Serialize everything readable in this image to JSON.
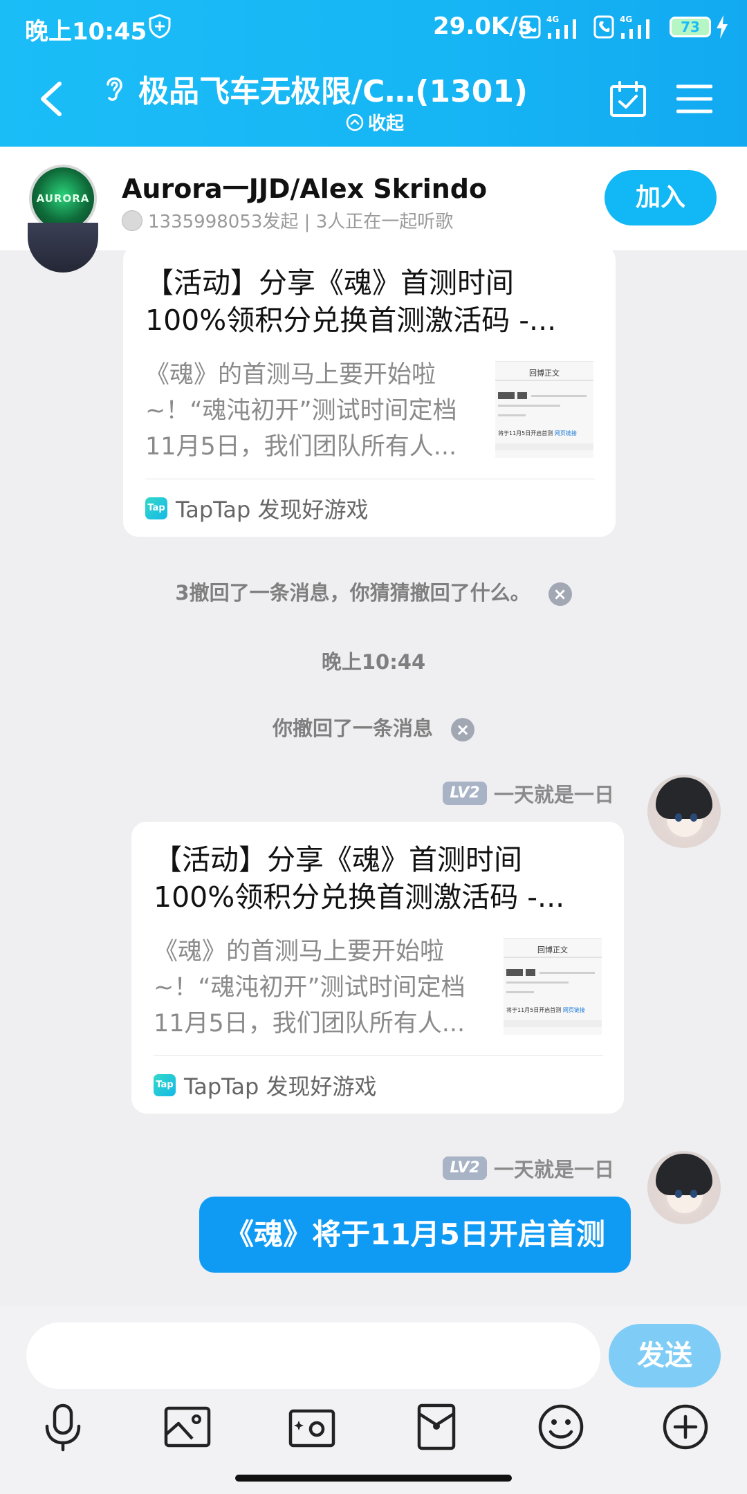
{
  "status_bar": {
    "time": "晚上10:45",
    "network_speed": "29.0K/s",
    "network_type_1": "4G",
    "network_type_2": "4G",
    "battery": "73"
  },
  "header": {
    "title": "极品飞车无极限/C…(1301)",
    "collapse_label": "收起"
  },
  "room": {
    "name": "Aurora一JJD/Alex Skrindo",
    "avatar_text": "AURORA",
    "sub": "1335998053发起 | 3人正在一起听歌",
    "join_label": "加入"
  },
  "messages": {
    "card1": {
      "title": "【活动】分享《魂》首测时间100%领积分兑换首测激活码 -...",
      "desc": "《魂》的首测马上要开始啦~！“魂沌初开”测试时间定档11月5日，我们团队所有人...",
      "thumb_title": "回博正文",
      "thumb_text": "将于11月5日开启首测",
      "thumb_link": "网页链接",
      "source": "TapTap 发现好游戏",
      "tap_icon": "Tap"
    },
    "recall_notice": "3撤回了一条消息，你猜猜撤回了什么。",
    "timestamp": "晚上10:44",
    "self_recall_notice": "你撤回了一条消息",
    "sender_level": "LV2",
    "sender_name": "一天就是一日",
    "card2": {
      "title": "【活动】分享《魂》首测时间100%领积分兑换首测激活码 -...",
      "desc": "《魂》的首测马上要开始啦~！“魂沌初开”测试时间定档11月5日，我们团队所有人...",
      "thumb_title": "回博正文",
      "thumb_text": "将于11月5日开启首测",
      "thumb_link": "网页链接",
      "source": "TapTap 发现好游戏",
      "tap_icon": "Tap"
    },
    "bubble_text": "《魂》将于11月5日开启首测"
  },
  "composer": {
    "placeholder": "",
    "send_label": "发送"
  },
  "toolbar": [
    "microphone-icon",
    "image-icon",
    "camera-icon",
    "red-packet-icon",
    "emoji-icon",
    "plus-icon"
  ],
  "colors": {
    "header": "#16b5f4",
    "accent": "#12b7f5",
    "bubble": "#0f9af4",
    "send_disabled": "#7fcdf6"
  }
}
